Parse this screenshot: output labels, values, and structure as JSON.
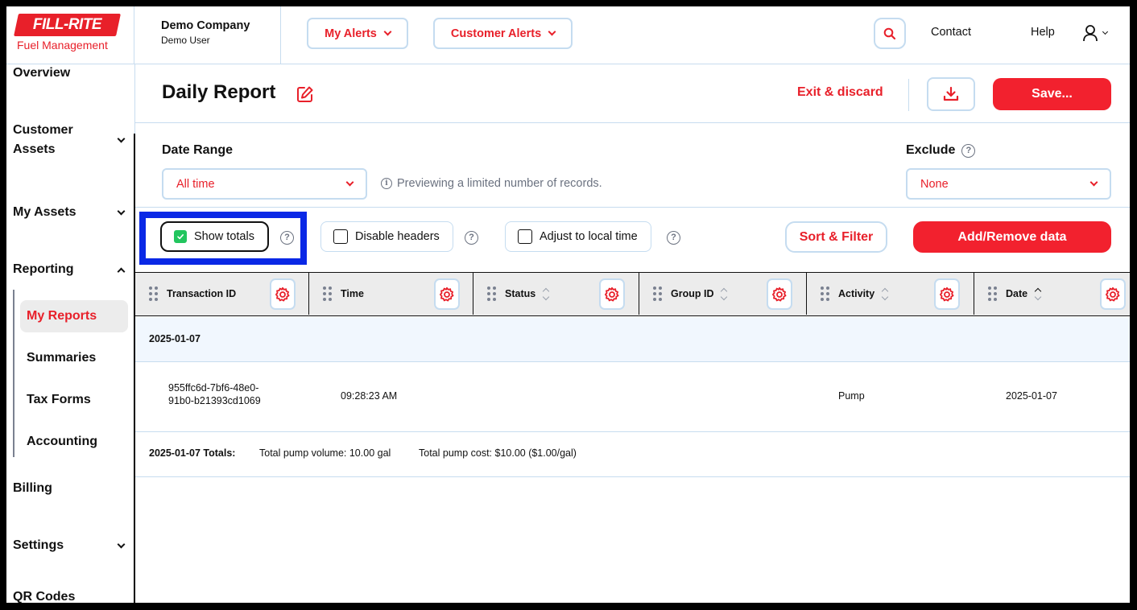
{
  "brand": {
    "logo_text": "FILL-RITE",
    "logo_subtitle": "Fuel Management",
    "accent_color": "#e8202a"
  },
  "header": {
    "company_name": "Demo Company",
    "user_name": "Demo User",
    "my_alerts_label": "My Alerts",
    "customer_alerts_label": "Customer Alerts",
    "search_icon": "search-icon",
    "contact_label": "Contact",
    "help_label": "Help",
    "user_icon": "user-icon"
  },
  "sidebar": {
    "items": [
      {
        "label": "Overview",
        "chevron": "none"
      },
      {
        "label": "Customer Assets",
        "chevron": "down"
      },
      {
        "label": "My Assets",
        "chevron": "down"
      },
      {
        "label": "Reporting",
        "chevron": "up"
      },
      {
        "label": "Billing",
        "chevron": "none"
      },
      {
        "label": "Settings",
        "chevron": "down"
      },
      {
        "label": "QR Codes",
        "chevron": "none"
      }
    ],
    "reporting_sub": [
      {
        "label": "My Reports",
        "active": true
      },
      {
        "label": "Summaries",
        "active": false
      },
      {
        "label": "Tax Forms",
        "active": false
      },
      {
        "label": "Accounting",
        "active": false
      }
    ]
  },
  "page": {
    "title": "Daily Report",
    "exit_label": "Exit & discard",
    "save_label": "Save...",
    "download_icon": "download-icon"
  },
  "filters": {
    "date_range_label": "Date Range",
    "date_range_value": "All time",
    "preview_note": "Previewing a limited number of records.",
    "exclude_label": "Exclude",
    "exclude_value": "None"
  },
  "options": {
    "show_totals": {
      "label": "Show totals",
      "checked": true
    },
    "disable_headers": {
      "label": "Disable headers",
      "checked": false
    },
    "adjust_local_time": {
      "label": "Adjust to local time",
      "checked": false
    },
    "sort_filter_label": "Sort & Filter",
    "add_remove_label": "Add/Remove data"
  },
  "table": {
    "columns": [
      {
        "label": "Transaction ID",
        "sortable": false
      },
      {
        "label": "Time",
        "sortable": false
      },
      {
        "label": "Status",
        "sortable": true,
        "sort": "none"
      },
      {
        "label": "Group ID",
        "sortable": true,
        "sort": "none"
      },
      {
        "label": "Activity",
        "sortable": true,
        "sort": "none"
      },
      {
        "label": "Date",
        "sortable": true,
        "sort": "asc"
      }
    ],
    "groups": [
      {
        "label": "2025-01-07",
        "rows": [
          {
            "transaction_id_line1": "955ffc6d-7bf6-48e0-",
            "transaction_id_line2": "91b0-b21393cd1069",
            "time": "09:28:23 AM",
            "status": "",
            "group_id": "",
            "activity": "Pump",
            "date": "2025-01-07"
          }
        ],
        "totals_label": "2025-01-07 Totals:",
        "total_volume": "Total pump volume: 10.00 gal",
        "total_cost": "Total pump cost: $10.00 ($1.00/gal)"
      }
    ]
  }
}
